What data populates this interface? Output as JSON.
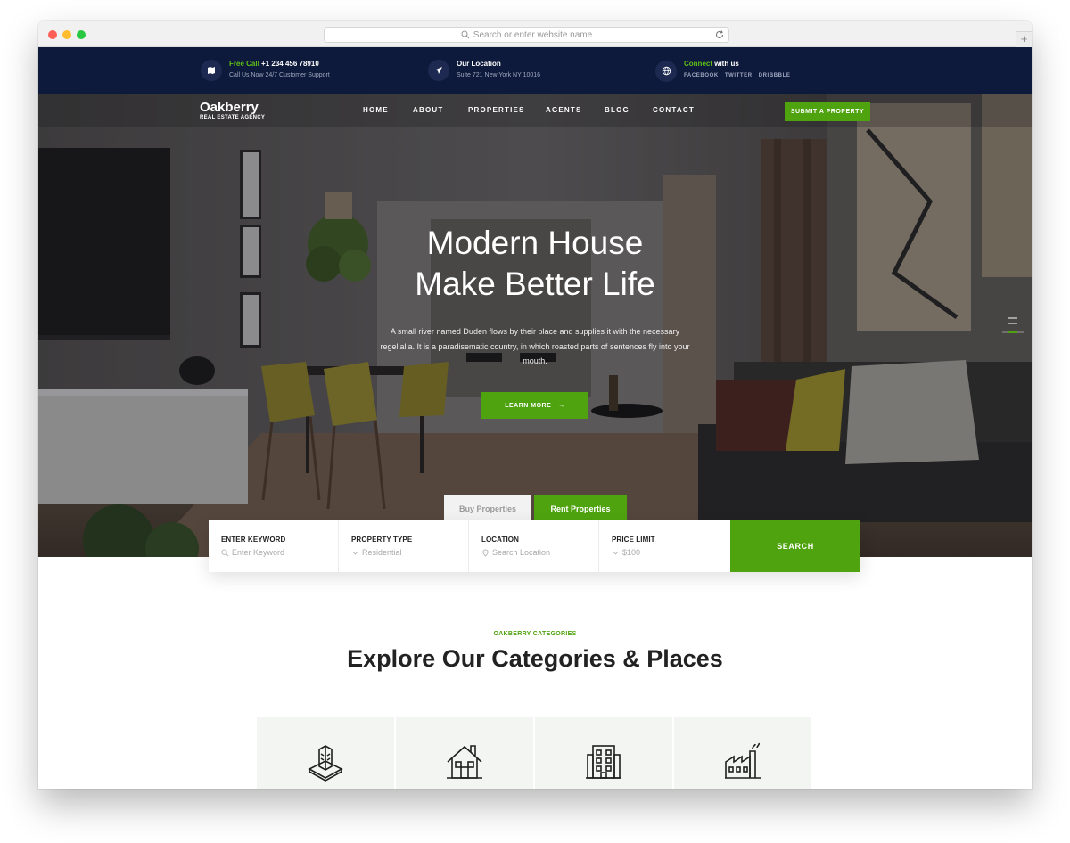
{
  "browser": {
    "url_placeholder": "Search or enter website name"
  },
  "topbar": {
    "call": {
      "prefix": "Free Call",
      "phone": "+1 234 456 78910",
      "sub": "Call Us Now 24/7 Customer Support"
    },
    "location": {
      "title": "Our Location",
      "sub": "Suite 721 New York NY 10016"
    },
    "connect": {
      "prefix": "Connect",
      "suffix": "with us",
      "links": [
        "FACEBOOK",
        "TWITTER",
        "DRIBBBLE"
      ]
    }
  },
  "nav": {
    "logo_name": "Oakberry",
    "logo_sub": "REAL ESTATE AGENCY",
    "items": [
      "HOME",
      "ABOUT",
      "PROPERTIES",
      "AGENTS",
      "BLOG",
      "CONTACT"
    ],
    "submit_label": "SUBMIT A PROPERTY"
  },
  "hero": {
    "title_line1": "Modern House",
    "title_line2": "Make Better Life",
    "text": "A small river named Duden flows by their place and supplies it with the necessary regelialia. It is a paradisematic country, in which roasted parts of sentences fly into your mouth.",
    "cta_label": "LEARN MORE",
    "cta_arrow": "→"
  },
  "tabs": {
    "buy": "Buy Properties",
    "rent": "Rent Properties"
  },
  "search": {
    "fields": [
      {
        "label": "ENTER KEYWORD",
        "value": "Enter Keyword",
        "icon": "search-icon"
      },
      {
        "label": "PROPERTY TYPE",
        "value": "Residential",
        "icon": "chevron-down-icon"
      },
      {
        "label": "LOCATION",
        "value": "Search Location",
        "icon": "location-pin-icon"
      },
      {
        "label": "PRICE LIMIT",
        "value": "$100",
        "icon": "chevron-down-icon"
      }
    ],
    "button_label": "SEARCH"
  },
  "categories": {
    "tag": "OAKBERRY CATEGORIES",
    "title": "Explore Our Categories & Places",
    "icons": [
      "skyscraper-icon",
      "house-icon",
      "apartment-building-icon",
      "factory-icon"
    ]
  },
  "colors": {
    "accent": "#4fa30f",
    "topbar": "#0e1a3b",
    "heading": "#222222"
  }
}
